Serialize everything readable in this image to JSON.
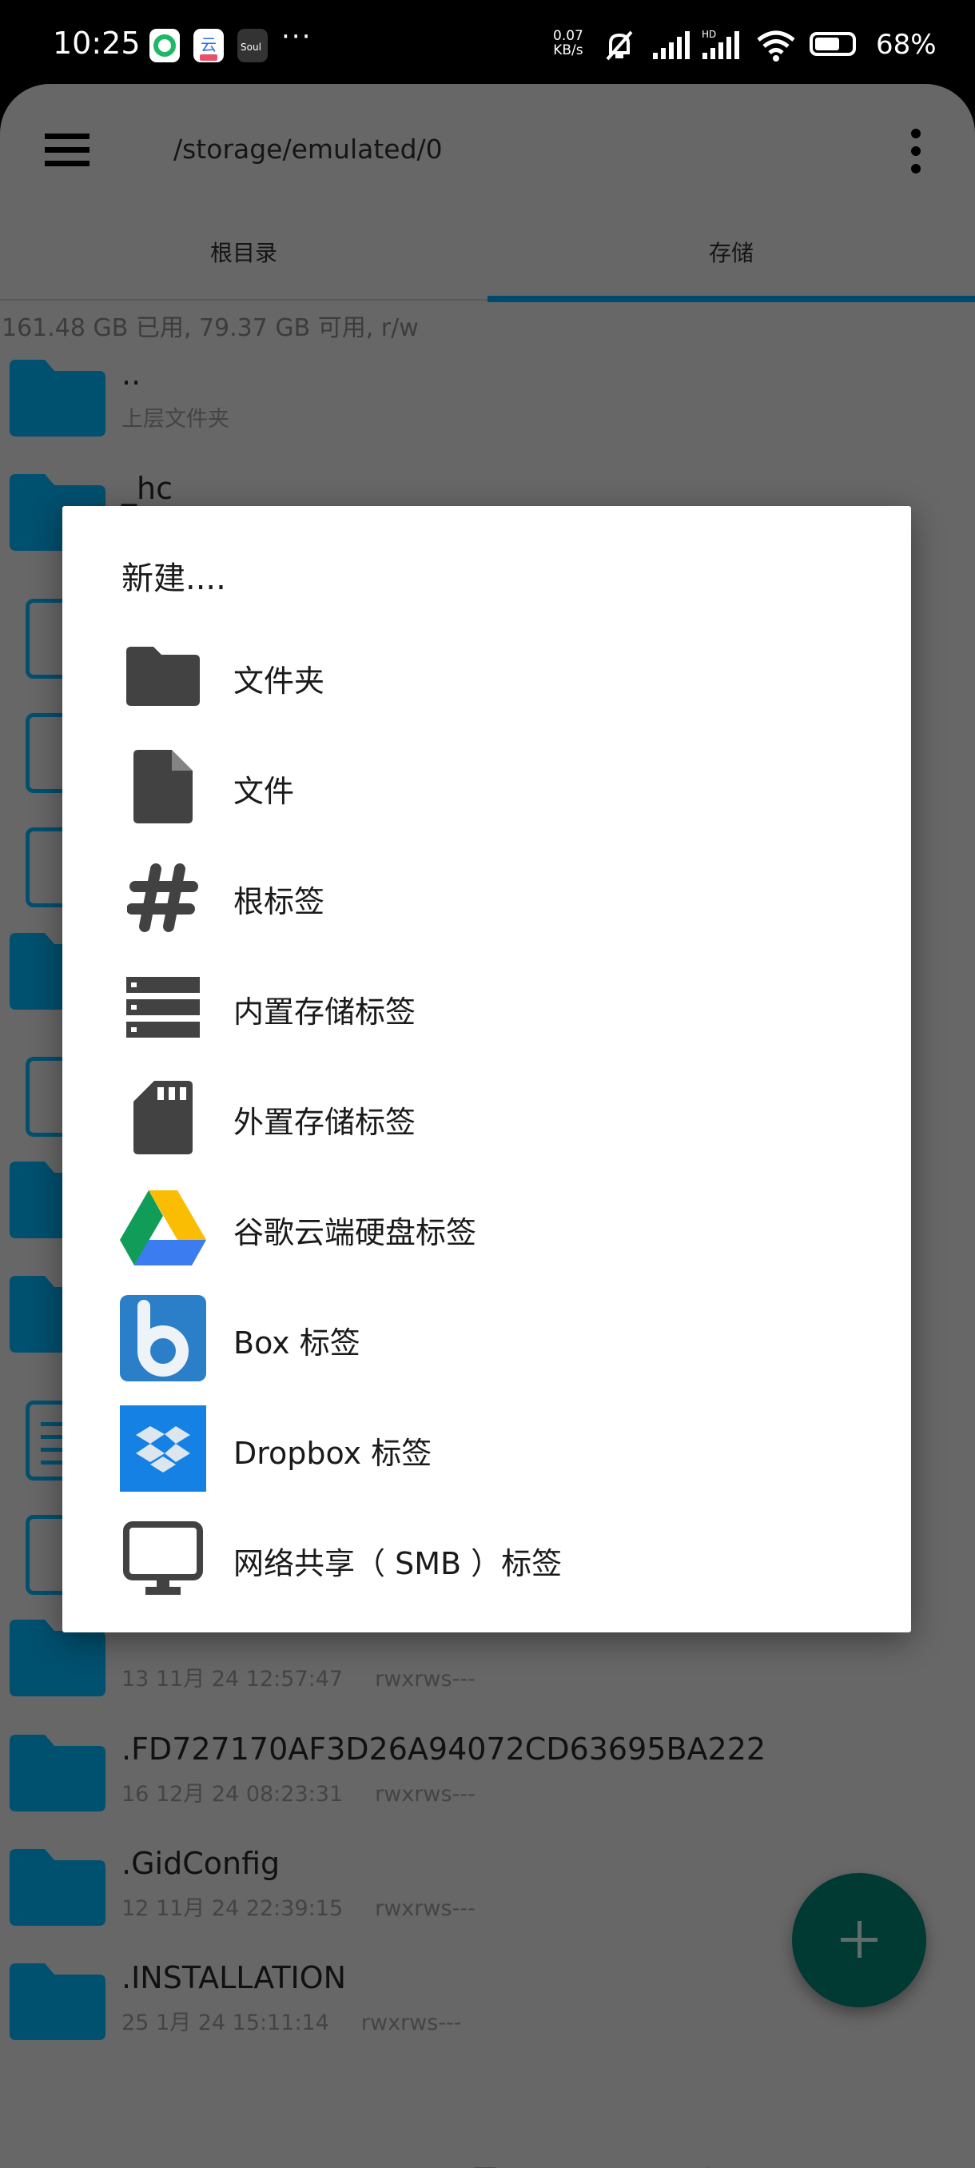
{
  "status_bar": {
    "time": "10:25",
    "notification_more": "···",
    "net_speed_value": "0.07",
    "net_speed_unit": "KB/s",
    "battery": "68%",
    "battery_level": 0.68,
    "signal_label": "HD"
  },
  "toolbar": {
    "path": "/storage/emulated/0"
  },
  "tabs": [
    {
      "label": "根目录",
      "selected": false
    },
    {
      "label": "存储",
      "selected": true
    }
  ],
  "storage_info": "161.48 GB 已用, 79.37 GB 可用, r/w",
  "files": [
    {
      "name": "..",
      "sub": "上层文件夹",
      "type": "folder"
    },
    {
      "name": "_hc",
      "type": "folder"
    },
    {
      "type": "file"
    },
    {
      "type": "file"
    },
    {
      "type": "file"
    },
    {
      "type": "folder"
    },
    {
      "type": "file"
    },
    {
      "type": "folder"
    },
    {
      "type": "folder"
    },
    {
      "type": "document"
    },
    {
      "type": "file"
    },
    {
      "date": "13 11月 24 12:57:47",
      "perm": "rwxrws---",
      "type": "folder"
    },
    {
      "name": ".FD727170AF3D26A94072CD63695BA222",
      "date": "16 12月 24 08:23:31",
      "perm": "rwxrws---",
      "type": "folder"
    },
    {
      "name": ".GidConfig",
      "date": "12 11月 24 22:39:15",
      "perm": "rwxrws---",
      "type": "folder"
    },
    {
      "name": ".INSTALLATION",
      "date": "25 1月 24 15:11:14",
      "perm": "rwxrws---",
      "type": "folder"
    }
  ],
  "dialog": {
    "title": "新建....",
    "items": [
      {
        "label": "文件夹",
        "icon": "folder-icon"
      },
      {
        "label": "文件",
        "icon": "file-icon"
      },
      {
        "label": "根标签",
        "icon": "hash-icon"
      },
      {
        "label": "内置存储标签",
        "icon": "internal-storage-icon"
      },
      {
        "label": "外置存储标签",
        "icon": "sd-card-icon"
      },
      {
        "label": "谷歌云端硬盘标签",
        "icon": "google-drive-icon"
      },
      {
        "label": "Box 标签",
        "icon": "box-icon"
      },
      {
        "label": "Dropbox 标签",
        "icon": "dropbox-icon"
      },
      {
        "label": "网络共享（ SMB ）标签",
        "icon": "monitor-icon"
      }
    ]
  },
  "colors": {
    "accent": "#004a6e",
    "folder": "#00506f",
    "fab": "#003a33",
    "dialog_icon": "#424242",
    "scrim_bg": "#676767"
  }
}
